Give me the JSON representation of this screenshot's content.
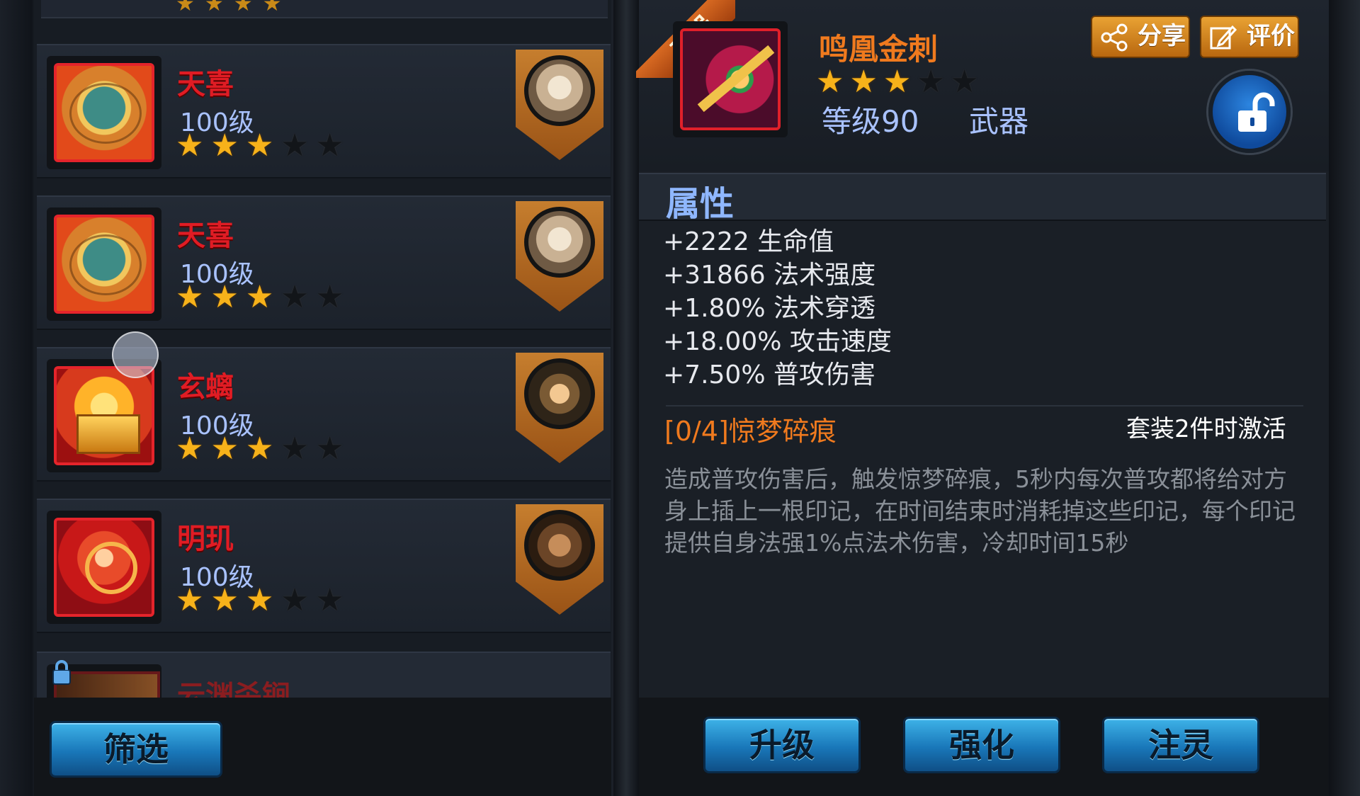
{
  "list": {
    "items": [
      {
        "name": "天喜",
        "level": "100级",
        "stars": 3,
        "max_stars": 5,
        "icon": "umbrella-icon",
        "portrait": "white-beast-portrait"
      },
      {
        "name": "天喜",
        "level": "100级",
        "stars": 3,
        "max_stars": 5,
        "icon": "umbrella-icon",
        "portrait": "white-beast-portrait"
      },
      {
        "name": "玄螭",
        "level": "100级",
        "stars": 3,
        "max_stars": 5,
        "icon": "dragon-seal-icon",
        "portrait": "warrior-portrait"
      },
      {
        "name": "明玑",
        "level": "100级",
        "stars": 3,
        "max_stars": 5,
        "icon": "orb-icon",
        "portrait": "bearded-hero-portrait"
      }
    ],
    "locked_item": {
      "name": "云渊杀锏",
      "icon": "lock-icon"
    },
    "filter_button": "筛选"
  },
  "detail": {
    "ribbon": "圣器",
    "name": "鸣凰金刺",
    "stars": 3,
    "max_stars": 5,
    "level": "等级90",
    "type": "武器",
    "share_button": "分享",
    "review_button": "评价",
    "lock_state": "unlocked",
    "section_title": "属性",
    "stats": [
      "+2222 生命值",
      "+31866 法术强度",
      "+1.80% 法术穿透",
      "+18.00% 攻击速度",
      "+7.50% 普攻伤害"
    ],
    "set_name": "[0/4]惊梦碎痕",
    "set_activation": "套装2件时激活",
    "set_description": "造成普攻伤害后，触发惊梦碎痕，5秒内每次普攻都将给对方身上插上一根印记，在时间结束时消耗掉这些印记，每个印记提供自身法强1%点法术伤害，冷却时间15秒"
  },
  "actions": {
    "upgrade": "升级",
    "enhance": "强化",
    "infuse": "注灵"
  },
  "colors": {
    "item_name_red": "#e01c24",
    "detail_name_orange": "#f07a1e",
    "level_blue": "#a9c2ff",
    "star_gold": "#f7b21a"
  }
}
